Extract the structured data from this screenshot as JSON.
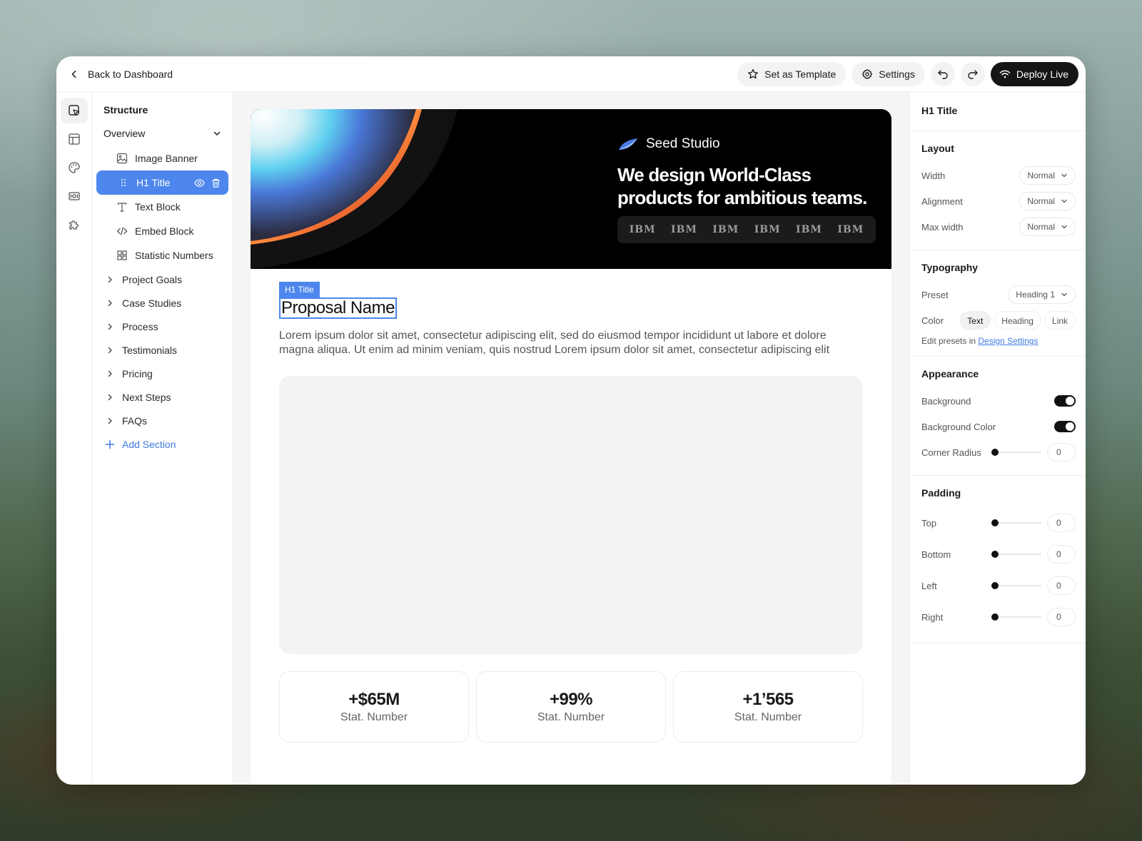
{
  "topbar": {
    "back_label": "Back to Dashboard",
    "template_label": "Set as Template",
    "settings_label": "Settings",
    "deploy_label": "Deploy Live"
  },
  "structure": {
    "title": "Structure",
    "overview_label": "Overview",
    "children": [
      {
        "label": "Image Banner",
        "icon": "image-icon"
      },
      {
        "label": "H1 Title",
        "icon": "drag-handle-icon",
        "selected": true
      },
      {
        "label": "Text Block",
        "icon": "text-icon"
      },
      {
        "label": "Embed Block",
        "icon": "code-icon"
      },
      {
        "label": "Statistic Numbers",
        "icon": "grid-icon"
      }
    ],
    "sections": [
      "Project Goals",
      "Case Studies",
      "Process",
      "Testimonials",
      "Pricing",
      "Next Steps",
      "FAQs"
    ],
    "add_section_label": "Add Section"
  },
  "canvas": {
    "banner": {
      "brand": "Seed Studio",
      "headline": "We design World-Class products for ambitious teams.",
      "logos": [
        "IBM",
        "IBM",
        "IBM",
        "IBM",
        "IBM",
        "IBM"
      ]
    },
    "h1_tag": "H1 Title",
    "h1_text": "Proposal Name",
    "body_text": "Lorem ipsum dolor sit amet, consectetur adipiscing elit, sed do eiusmod tempor incididunt ut labore et dolore magna aliqua. Ut enim ad minim veniam, quis nostrud Lorem ipsum dolor sit amet, consectetur adipiscing elit",
    "stats": [
      {
        "value": "+$65M",
        "label": "Stat. Number"
      },
      {
        "value": "+99%",
        "label": "Stat. Number"
      },
      {
        "value": "+1’565",
        "label": "Stat. Number"
      }
    ]
  },
  "props": {
    "title": "H1 Title",
    "layout": {
      "title": "Layout",
      "width_label": "Width",
      "width_value": "Normal",
      "alignment_label": "Alignment",
      "alignment_value": "Normal",
      "maxwidth_label": "Max width",
      "maxwidth_value": "Normal"
    },
    "typography": {
      "title": "Typography",
      "preset_label": "Preset",
      "preset_value": "Heading 1",
      "color_label": "Color",
      "color_options": [
        "Text",
        "Heading",
        "Link"
      ],
      "edit_prefix": "Edit presets in",
      "edit_link": "Design Settings"
    },
    "appearance": {
      "title": "Appearance",
      "background_label": "Background",
      "bgcolor_label": "Background Color",
      "radius_label": "Corner Radius",
      "radius_value": "0"
    },
    "padding": {
      "title": "Padding",
      "top_label": "Top",
      "top_value": "0",
      "bottom_label": "Bottom",
      "bottom_value": "0",
      "left_label": "Left",
      "left_value": "0",
      "right_label": "Right",
      "right_value": "0"
    }
  },
  "colors": {
    "accent": "#4d86ec",
    "link": "#3f7be4",
    "dark": "#151515"
  }
}
